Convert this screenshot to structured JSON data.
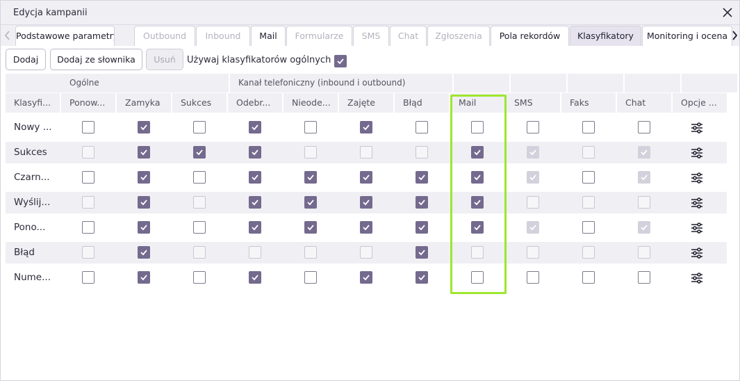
{
  "window": {
    "title": "Edycja kampanii"
  },
  "tabs": [
    {
      "label": "Podstawowe parametry",
      "state": "normal"
    },
    {
      "label": "Outbound",
      "state": "disabled"
    },
    {
      "label": "Inbound",
      "state": "disabled"
    },
    {
      "label": "Mail",
      "state": "normal"
    },
    {
      "label": "Formularze",
      "state": "disabled"
    },
    {
      "label": "SMS",
      "state": "disabled"
    },
    {
      "label": "Chat",
      "state": "disabled"
    },
    {
      "label": "Zgłoszenia",
      "state": "disabled"
    },
    {
      "label": "Pola rekordów",
      "state": "normal"
    },
    {
      "label": "Klasyfikatory",
      "state": "active"
    },
    {
      "label": "Monitoring i ocena",
      "state": "normal"
    }
  ],
  "toolbar": {
    "add_label": "Dodaj",
    "add_from_dict_label": "Dodaj ze słownika",
    "remove_label": "Usuń",
    "use_general_label": "Używaj klasyfikatorów ogólnych",
    "use_general_checked": true
  },
  "table": {
    "groups": [
      "",
      "Ogólne",
      "Kanał telefoniczny (inbound i outbound)",
      "",
      "",
      "",
      "",
      ""
    ],
    "columns": [
      "Klasyfi...",
      "Ponow...",
      "Zamyka",
      "Sukces",
      "Odebr...",
      "Nieode...",
      "Zajęte",
      "Błąd",
      "Mail",
      "SMS",
      "Faks",
      "Chat",
      "Opcje ..."
    ],
    "rows": [
      {
        "label": "Nowy ...",
        "cells": [
          "u",
          "c",
          "u",
          "c",
          "u",
          "c",
          "u",
          "u",
          "u",
          "u",
          "u"
        ]
      },
      {
        "label": "Sukces",
        "cells": [
          "d",
          "c",
          "c",
          "c",
          "d",
          "d",
          "d",
          "c",
          "dc",
          "d",
          "dc"
        ]
      },
      {
        "label": "Czarn...",
        "cells": [
          "u",
          "c",
          "u",
          "c",
          "c",
          "c",
          "c",
          "c",
          "dc",
          "u",
          "dc"
        ]
      },
      {
        "label": "Wyślij...",
        "cells": [
          "d",
          "c",
          "d",
          "c",
          "c",
          "c",
          "c",
          "c",
          "d",
          "d",
          "d"
        ]
      },
      {
        "label": "Pono...",
        "cells": [
          "u",
          "c",
          "u",
          "c",
          "c",
          "c",
          "c",
          "c",
          "dc",
          "u",
          "dc"
        ]
      },
      {
        "label": "Błąd",
        "cells": [
          "d",
          "c",
          "d",
          "d",
          "d",
          "d",
          "c",
          "d",
          "d",
          "d",
          "d"
        ]
      },
      {
        "label": "Nume...",
        "cells": [
          "u",
          "c",
          "u",
          "c",
          "u",
          "c",
          "c",
          "u",
          "u",
          "u",
          "u"
        ]
      }
    ]
  },
  "icons": {
    "options": "sliders-icon",
    "close": "close-icon"
  },
  "colors": {
    "accent": "#746a8e",
    "highlight": "#9ee62e"
  }
}
